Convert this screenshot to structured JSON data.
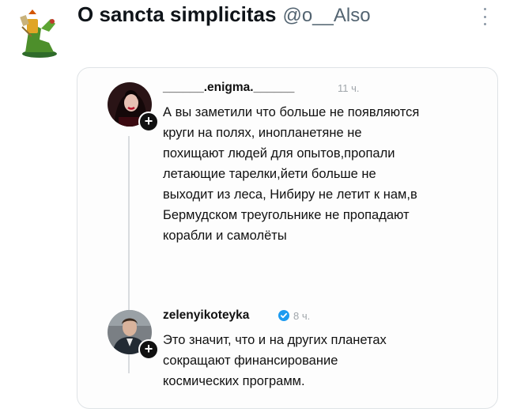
{
  "tweet": {
    "author_name": "O sancta simplicitas",
    "author_handle": "@o__Also"
  },
  "thread": [
    {
      "username": "______.enigma.______",
      "time": "11 ч.",
      "text": "А вы заметили что больше не появляются\nкруги на полях, инопланетяне не\nпохищают людей для опытов,пропали\nлетающие тарелки,йети больше не\nвыходит из леса, Нибиру не летит к нам,в\nБермудском треугольнике не пропадают\nкорабли и самолёты"
    },
    {
      "username": "zelenyikoteyka",
      "time": "8 ч.",
      "verified": true,
      "text": "Это значит, что и на других планетах\nсокращают финансирование\nкосмических программ."
    }
  ],
  "plus_symbol": "+",
  "colors": {
    "verified": "#1d9bf0",
    "secondary_text": "#536471",
    "thread_line": "#d9dcdf"
  },
  "icons": {
    "more": "three-dots-vertical-icon",
    "verified": "verified-badge-icon",
    "follow": "plus-icon"
  }
}
